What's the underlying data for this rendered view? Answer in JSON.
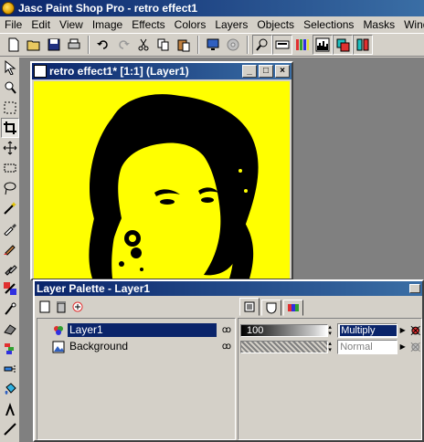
{
  "app": {
    "title": "Jasc Paint Shop Pro - retro effect1"
  },
  "menu": [
    "File",
    "Edit",
    "View",
    "Image",
    "Effects",
    "Colors",
    "Layers",
    "Objects",
    "Selections",
    "Masks",
    "Window"
  ],
  "toolbar_icons": [
    "new-icon",
    "open-icon",
    "save-icon",
    "print-icon",
    "undo-icon",
    "redo-icon",
    "cut-icon",
    "copy-icon",
    "paste-icon",
    "full-screen-icon",
    "browse-icon",
    "overview-icon",
    "tool-options-icon",
    "color-palette-icon",
    "histogram-icon",
    "layer-palette-icon",
    "controls-icon"
  ],
  "tools": [
    "arrow-icon",
    "zoom-icon",
    "deformation-icon",
    "crop-icon",
    "mover-icon",
    "selection-icon",
    "freehand-icon",
    "magic-wand-icon",
    "dropper-icon",
    "paintbrush-icon",
    "clone-brush-icon",
    "color-replacer-icon",
    "retouch-icon",
    "eraser-icon",
    "picture-tube-icon",
    "airbrush-icon",
    "flood-fill-icon",
    "text-icon",
    "draw-icon"
  ],
  "document": {
    "title": "retro effect1* [1:1] (Layer1)",
    "canvas_color": "#ffff00"
  },
  "layer_palette": {
    "title": "Layer Palette - Layer1",
    "layers": [
      {
        "name": "Layer1",
        "selected": true,
        "opacity": 100,
        "opacity_label": "100",
        "blend": "Multiply",
        "enabled": true
      },
      {
        "name": "Background",
        "selected": false,
        "opacity": null,
        "opacity_label": "",
        "blend": "Normal",
        "enabled": false
      }
    ],
    "visible_glyph": "ꝏ"
  },
  "colors": {
    "title_start": "#0a246a",
    "title_end": "#3a6ea5",
    "face": "#d4d0c8",
    "workspace": "#808080",
    "canvas": "#ffff00"
  }
}
